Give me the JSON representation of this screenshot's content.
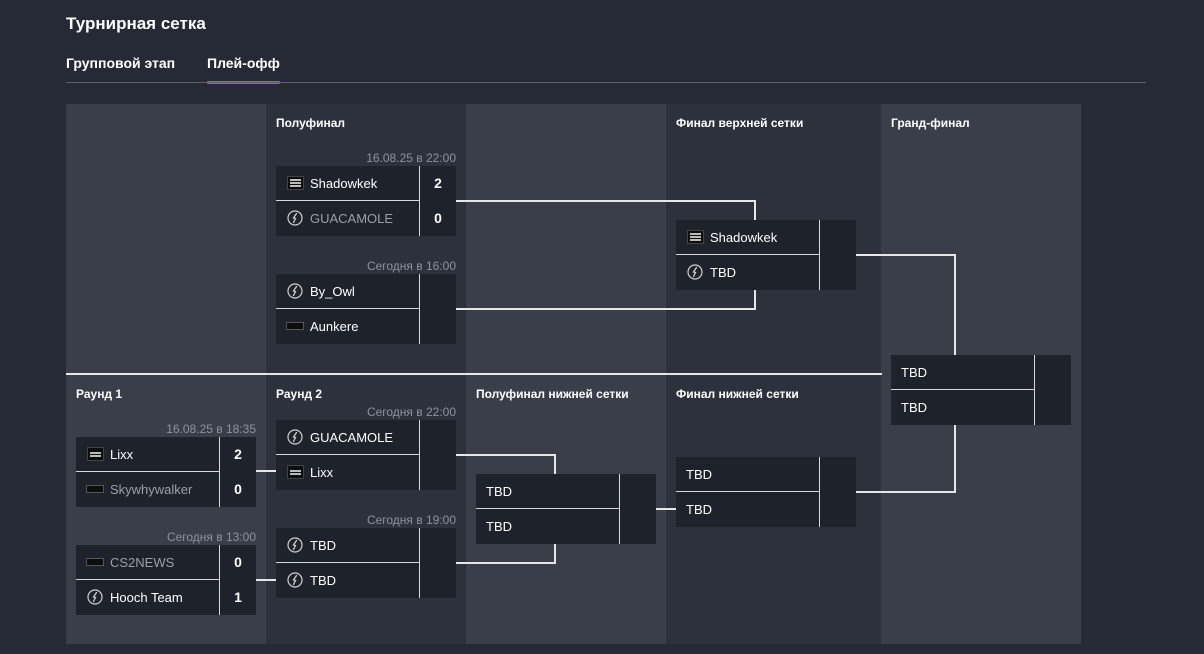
{
  "page": {
    "title": "Турнирная сетка"
  },
  "tabs": [
    {
      "label": "Групповой этап",
      "active": false
    },
    {
      "label": "Плей-офф",
      "active": true
    }
  ],
  "rounds": {
    "upper_semifinal": "Полуфинал",
    "upper_final": "Финал верхней сетки",
    "grand_final": "Гранд-финал",
    "round1": "Раунд 1",
    "round2": "Раунд 2",
    "lower_semifinal": "Полуфинал нижней сетки",
    "lower_final": "Финал нижней сетки"
  },
  "matches": {
    "usf1": {
      "time": "16.08.25 в 22:00",
      "t1": {
        "name": "Shadowkek",
        "score": "2",
        "logo": "shadowkek-logo"
      },
      "t2": {
        "name": "GUACAMOLE",
        "score": "0",
        "logo": "placeholder-player-icon"
      }
    },
    "usf2": {
      "time": "Сегодня в 16:00",
      "t1": {
        "name": "By_Owl",
        "score": "",
        "logo": "placeholder-player-icon"
      },
      "t2": {
        "name": "Aunkere",
        "score": "",
        "logo": "aunkere-logo"
      }
    },
    "uf": {
      "time": "",
      "t1": {
        "name": "Shadowkek",
        "score": "",
        "logo": "shadowkek-logo"
      },
      "t2": {
        "name": "TBD",
        "score": "",
        "logo": "placeholder-player-icon"
      }
    },
    "gf": {
      "time": "",
      "t1": {
        "name": "TBD",
        "score": ""
      },
      "t2": {
        "name": "TBD",
        "score": ""
      }
    },
    "r1m1": {
      "time": "16.08.25 в 18:35",
      "t1": {
        "name": "Lixx",
        "score": "2",
        "logo": "lixx-logo"
      },
      "t2": {
        "name": "Skywhywalker",
        "score": "0",
        "logo": "skywhywalker-logo"
      }
    },
    "r1m2": {
      "time": "Сегодня в 13:00",
      "t1": {
        "name": "CS2NEWS",
        "score": "0",
        "logo": "cs2news-logo"
      },
      "t2": {
        "name": "Hooch Team",
        "score": "1",
        "logo": "placeholder-player-icon"
      }
    },
    "r2m1": {
      "time": "Сегодня в 22:00",
      "t1": {
        "name": "GUACAMOLE",
        "score": "",
        "logo": "placeholder-player-icon"
      },
      "t2": {
        "name": "Lixx",
        "score": "",
        "logo": "lixx-logo"
      }
    },
    "r2m2": {
      "time": "Сегодня в 19:00",
      "t1": {
        "name": "TBD",
        "score": "",
        "logo": "placeholder-player-icon"
      },
      "t2": {
        "name": "TBD",
        "score": "",
        "logo": "placeholder-player-icon"
      }
    },
    "lsf": {
      "time": "",
      "t1": {
        "name": "TBD",
        "score": ""
      },
      "t2": {
        "name": "TBD",
        "score": ""
      }
    },
    "lf": {
      "time": "",
      "t1": {
        "name": "TBD",
        "score": ""
      },
      "t2": {
        "name": "TBD",
        "score": ""
      }
    }
  },
  "colors": {
    "background": "#262a34",
    "column_light": "#3a3e48",
    "column_dark": "#2d313b",
    "card": "#1e222b",
    "accent": "#e8561f",
    "muted_text": "#8d939e"
  }
}
